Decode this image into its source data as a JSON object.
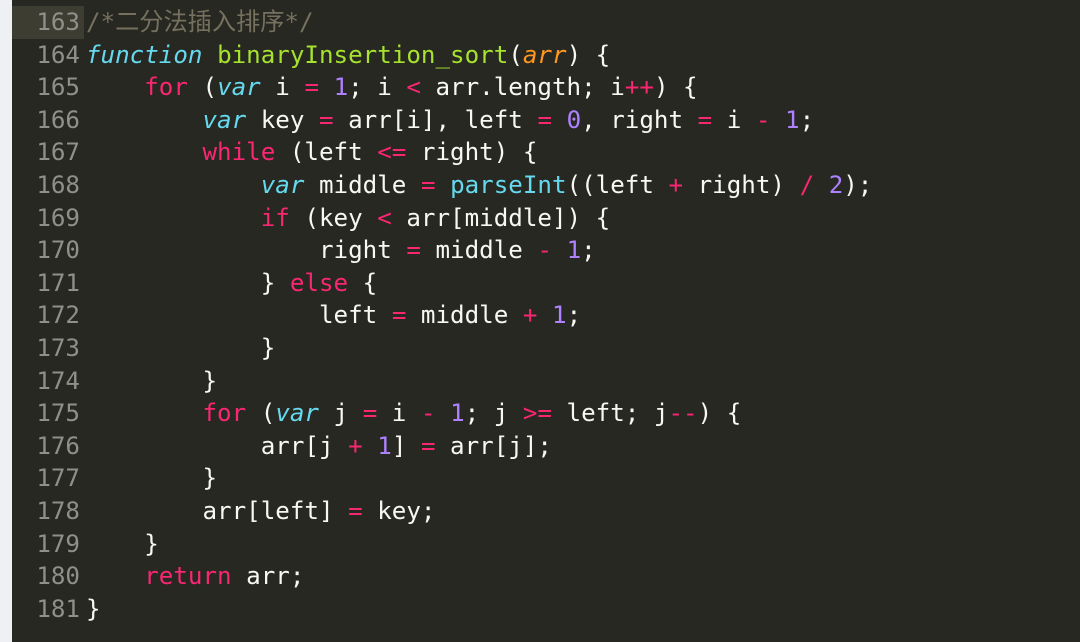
{
  "editor": {
    "active_line": 163,
    "colors": {
      "background": "#272822",
      "keyword": "#f92672",
      "storage": "#66d9ef",
      "function_name": "#a6e22e",
      "parameter": "#fd971f",
      "number": "#ae81ff",
      "comment": "#75715e",
      "text": "#f8f8f2"
    },
    "lines": [
      {
        "n": "163",
        "tokens": [
          [
            "cm",
            "/*二分法插入排序*/"
          ]
        ]
      },
      {
        "n": "164",
        "tokens": [
          [
            "st",
            "function"
          ],
          [
            "pl",
            " "
          ],
          [
            "fn",
            "binaryInsertion_sort"
          ],
          [
            "pl",
            "("
          ],
          [
            "pa",
            "arr"
          ],
          [
            "pl",
            ") {"
          ]
        ]
      },
      {
        "n": "165",
        "tokens": [
          [
            "pl",
            "    "
          ],
          [
            "kw",
            "for"
          ],
          [
            "pl",
            " ("
          ],
          [
            "st",
            "var"
          ],
          [
            "pl",
            " i "
          ],
          [
            "op",
            "="
          ],
          [
            "pl",
            " "
          ],
          [
            "nu",
            "1"
          ],
          [
            "pl",
            "; i "
          ],
          [
            "op",
            "<"
          ],
          [
            "pl",
            " arr.length; i"
          ],
          [
            "op",
            "++"
          ],
          [
            "pl",
            ") {"
          ]
        ]
      },
      {
        "n": "166",
        "tokens": [
          [
            "pl",
            "        "
          ],
          [
            "st",
            "var"
          ],
          [
            "pl",
            " key "
          ],
          [
            "op",
            "="
          ],
          [
            "pl",
            " arr[i], left "
          ],
          [
            "op",
            "="
          ],
          [
            "pl",
            " "
          ],
          [
            "nu",
            "0"
          ],
          [
            "pl",
            ", right "
          ],
          [
            "op",
            "="
          ],
          [
            "pl",
            " i "
          ],
          [
            "op",
            "-"
          ],
          [
            "pl",
            " "
          ],
          [
            "nu",
            "1"
          ],
          [
            "pl",
            ";"
          ]
        ]
      },
      {
        "n": "167",
        "tokens": [
          [
            "pl",
            "        "
          ],
          [
            "kw",
            "while"
          ],
          [
            "pl",
            " (left "
          ],
          [
            "op",
            "<="
          ],
          [
            "pl",
            " right) {"
          ]
        ]
      },
      {
        "n": "168",
        "tokens": [
          [
            "pl",
            "            "
          ],
          [
            "st",
            "var"
          ],
          [
            "pl",
            " middle "
          ],
          [
            "op",
            "="
          ],
          [
            "pl",
            " "
          ],
          [
            "bi",
            "parseInt"
          ],
          [
            "pl",
            "((left "
          ],
          [
            "op",
            "+"
          ],
          [
            "pl",
            " right) "
          ],
          [
            "op",
            "/"
          ],
          [
            "pl",
            " "
          ],
          [
            "nu",
            "2"
          ],
          [
            "pl",
            ");"
          ]
        ]
      },
      {
        "n": "169",
        "tokens": [
          [
            "pl",
            "            "
          ],
          [
            "kw",
            "if"
          ],
          [
            "pl",
            " (key "
          ],
          [
            "op",
            "<"
          ],
          [
            "pl",
            " arr[middle]) {"
          ]
        ]
      },
      {
        "n": "170",
        "tokens": [
          [
            "pl",
            "                right "
          ],
          [
            "op",
            "="
          ],
          [
            "pl",
            " middle "
          ],
          [
            "op",
            "-"
          ],
          [
            "pl",
            " "
          ],
          [
            "nu",
            "1"
          ],
          [
            "pl",
            ";"
          ]
        ]
      },
      {
        "n": "171",
        "tokens": [
          [
            "pl",
            "            } "
          ],
          [
            "kw",
            "else"
          ],
          [
            "pl",
            " {"
          ]
        ]
      },
      {
        "n": "172",
        "tokens": [
          [
            "pl",
            "                left "
          ],
          [
            "op",
            "="
          ],
          [
            "pl",
            " middle "
          ],
          [
            "op",
            "+"
          ],
          [
            "pl",
            " "
          ],
          [
            "nu",
            "1"
          ],
          [
            "pl",
            ";"
          ]
        ]
      },
      {
        "n": "173",
        "tokens": [
          [
            "pl",
            "            }"
          ]
        ]
      },
      {
        "n": "174",
        "tokens": [
          [
            "pl",
            "        }"
          ]
        ]
      },
      {
        "n": "175",
        "tokens": [
          [
            "pl",
            "        "
          ],
          [
            "kw",
            "for"
          ],
          [
            "pl",
            " ("
          ],
          [
            "st",
            "var"
          ],
          [
            "pl",
            " j "
          ],
          [
            "op",
            "="
          ],
          [
            "pl",
            " i "
          ],
          [
            "op",
            "-"
          ],
          [
            "pl",
            " "
          ],
          [
            "nu",
            "1"
          ],
          [
            "pl",
            "; j "
          ],
          [
            "op",
            ">="
          ],
          [
            "pl",
            " left; j"
          ],
          [
            "op",
            "--"
          ],
          [
            "pl",
            ") {"
          ]
        ]
      },
      {
        "n": "176",
        "tokens": [
          [
            "pl",
            "            arr[j "
          ],
          [
            "op",
            "+"
          ],
          [
            "pl",
            " "
          ],
          [
            "nu",
            "1"
          ],
          [
            "pl",
            "] "
          ],
          [
            "op",
            "="
          ],
          [
            "pl",
            " arr[j];"
          ]
        ]
      },
      {
        "n": "177",
        "tokens": [
          [
            "pl",
            "        }"
          ]
        ]
      },
      {
        "n": "178",
        "tokens": [
          [
            "pl",
            "        arr[left] "
          ],
          [
            "op",
            "="
          ],
          [
            "pl",
            " key;"
          ]
        ]
      },
      {
        "n": "179",
        "tokens": [
          [
            "pl",
            "    }"
          ]
        ]
      },
      {
        "n": "180",
        "tokens": [
          [
            "pl",
            "    "
          ],
          [
            "kw",
            "return"
          ],
          [
            "pl",
            " arr;"
          ]
        ]
      },
      {
        "n": "181",
        "tokens": [
          [
            "pl",
            "}"
          ]
        ]
      }
    ]
  }
}
